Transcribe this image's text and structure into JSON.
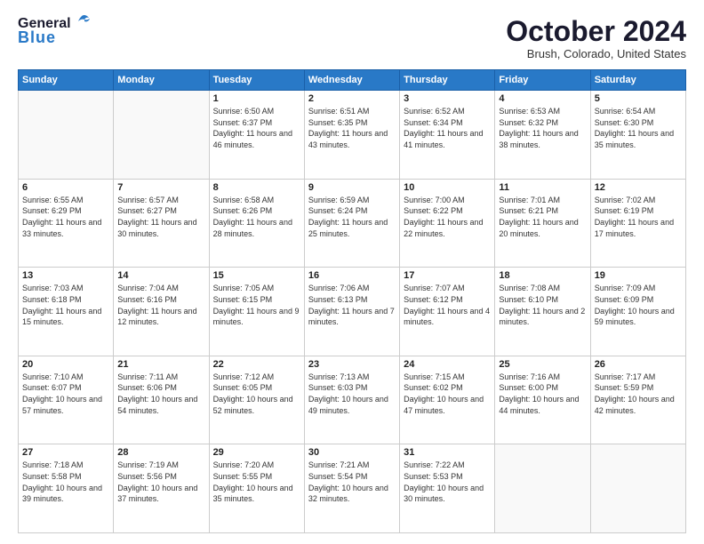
{
  "header": {
    "logo_general": "General",
    "logo_blue": "Blue",
    "month": "October 2024",
    "location": "Brush, Colorado, United States"
  },
  "weekdays": [
    "Sunday",
    "Monday",
    "Tuesday",
    "Wednesday",
    "Thursday",
    "Friday",
    "Saturday"
  ],
  "weeks": [
    [
      {
        "day": "",
        "info": ""
      },
      {
        "day": "",
        "info": ""
      },
      {
        "day": "1",
        "info": "Sunrise: 6:50 AM\nSunset: 6:37 PM\nDaylight: 11 hours and 46 minutes."
      },
      {
        "day": "2",
        "info": "Sunrise: 6:51 AM\nSunset: 6:35 PM\nDaylight: 11 hours and 43 minutes."
      },
      {
        "day": "3",
        "info": "Sunrise: 6:52 AM\nSunset: 6:34 PM\nDaylight: 11 hours and 41 minutes."
      },
      {
        "day": "4",
        "info": "Sunrise: 6:53 AM\nSunset: 6:32 PM\nDaylight: 11 hours and 38 minutes."
      },
      {
        "day": "5",
        "info": "Sunrise: 6:54 AM\nSunset: 6:30 PM\nDaylight: 11 hours and 35 minutes."
      }
    ],
    [
      {
        "day": "6",
        "info": "Sunrise: 6:55 AM\nSunset: 6:29 PM\nDaylight: 11 hours and 33 minutes."
      },
      {
        "day": "7",
        "info": "Sunrise: 6:57 AM\nSunset: 6:27 PM\nDaylight: 11 hours and 30 minutes."
      },
      {
        "day": "8",
        "info": "Sunrise: 6:58 AM\nSunset: 6:26 PM\nDaylight: 11 hours and 28 minutes."
      },
      {
        "day": "9",
        "info": "Sunrise: 6:59 AM\nSunset: 6:24 PM\nDaylight: 11 hours and 25 minutes."
      },
      {
        "day": "10",
        "info": "Sunrise: 7:00 AM\nSunset: 6:22 PM\nDaylight: 11 hours and 22 minutes."
      },
      {
        "day": "11",
        "info": "Sunrise: 7:01 AM\nSunset: 6:21 PM\nDaylight: 11 hours and 20 minutes."
      },
      {
        "day": "12",
        "info": "Sunrise: 7:02 AM\nSunset: 6:19 PM\nDaylight: 11 hours and 17 minutes."
      }
    ],
    [
      {
        "day": "13",
        "info": "Sunrise: 7:03 AM\nSunset: 6:18 PM\nDaylight: 11 hours and 15 minutes."
      },
      {
        "day": "14",
        "info": "Sunrise: 7:04 AM\nSunset: 6:16 PM\nDaylight: 11 hours and 12 minutes."
      },
      {
        "day": "15",
        "info": "Sunrise: 7:05 AM\nSunset: 6:15 PM\nDaylight: 11 hours and 9 minutes."
      },
      {
        "day": "16",
        "info": "Sunrise: 7:06 AM\nSunset: 6:13 PM\nDaylight: 11 hours and 7 minutes."
      },
      {
        "day": "17",
        "info": "Sunrise: 7:07 AM\nSunset: 6:12 PM\nDaylight: 11 hours and 4 minutes."
      },
      {
        "day": "18",
        "info": "Sunrise: 7:08 AM\nSunset: 6:10 PM\nDaylight: 11 hours and 2 minutes."
      },
      {
        "day": "19",
        "info": "Sunrise: 7:09 AM\nSunset: 6:09 PM\nDaylight: 10 hours and 59 minutes."
      }
    ],
    [
      {
        "day": "20",
        "info": "Sunrise: 7:10 AM\nSunset: 6:07 PM\nDaylight: 10 hours and 57 minutes."
      },
      {
        "day": "21",
        "info": "Sunrise: 7:11 AM\nSunset: 6:06 PM\nDaylight: 10 hours and 54 minutes."
      },
      {
        "day": "22",
        "info": "Sunrise: 7:12 AM\nSunset: 6:05 PM\nDaylight: 10 hours and 52 minutes."
      },
      {
        "day": "23",
        "info": "Sunrise: 7:13 AM\nSunset: 6:03 PM\nDaylight: 10 hours and 49 minutes."
      },
      {
        "day": "24",
        "info": "Sunrise: 7:15 AM\nSunset: 6:02 PM\nDaylight: 10 hours and 47 minutes."
      },
      {
        "day": "25",
        "info": "Sunrise: 7:16 AM\nSunset: 6:00 PM\nDaylight: 10 hours and 44 minutes."
      },
      {
        "day": "26",
        "info": "Sunrise: 7:17 AM\nSunset: 5:59 PM\nDaylight: 10 hours and 42 minutes."
      }
    ],
    [
      {
        "day": "27",
        "info": "Sunrise: 7:18 AM\nSunset: 5:58 PM\nDaylight: 10 hours and 39 minutes."
      },
      {
        "day": "28",
        "info": "Sunrise: 7:19 AM\nSunset: 5:56 PM\nDaylight: 10 hours and 37 minutes."
      },
      {
        "day": "29",
        "info": "Sunrise: 7:20 AM\nSunset: 5:55 PM\nDaylight: 10 hours and 35 minutes."
      },
      {
        "day": "30",
        "info": "Sunrise: 7:21 AM\nSunset: 5:54 PM\nDaylight: 10 hours and 32 minutes."
      },
      {
        "day": "31",
        "info": "Sunrise: 7:22 AM\nSunset: 5:53 PM\nDaylight: 10 hours and 30 minutes."
      },
      {
        "day": "",
        "info": ""
      },
      {
        "day": "",
        "info": ""
      }
    ]
  ]
}
